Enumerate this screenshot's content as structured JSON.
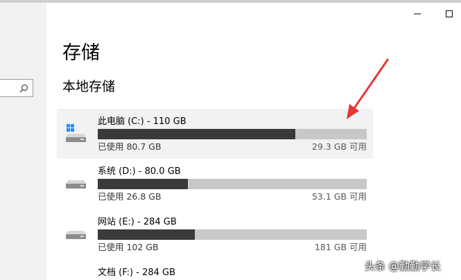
{
  "page": {
    "title": "存储",
    "section_title": "本地存储"
  },
  "window": {
    "minimize_icon": "minimize-icon",
    "maximize_icon": "maximize-icon"
  },
  "sidebar": {
    "search_icon": "search-icon"
  },
  "drives": [
    {
      "name": "此电脑 (C:) - 110 GB",
      "used_label": "已使用 80.7 GB",
      "free_label": "29.3 GB 可用",
      "used_fraction": 0.734,
      "icon": "windows-drive-icon",
      "selected": true
    },
    {
      "name": "系统 (D:) - 80.0 GB",
      "used_label": "已使用 26.8 GB",
      "free_label": "53.1 GB 可用",
      "used_fraction": 0.335,
      "icon": "drive-icon",
      "selected": false
    },
    {
      "name": "网站 (E:) - 284 GB",
      "used_label": "已使用 102 GB",
      "free_label": "181 GB 可用",
      "used_fraction": 0.36,
      "icon": "drive-icon",
      "selected": false
    },
    {
      "name": "文档 (F:) - 284 GB",
      "icon": "drive-icon",
      "selected": false
    }
  ],
  "annotation": {
    "arrow_color": "#e53935"
  },
  "watermark": {
    "text": "头条 @勤勤学长"
  }
}
